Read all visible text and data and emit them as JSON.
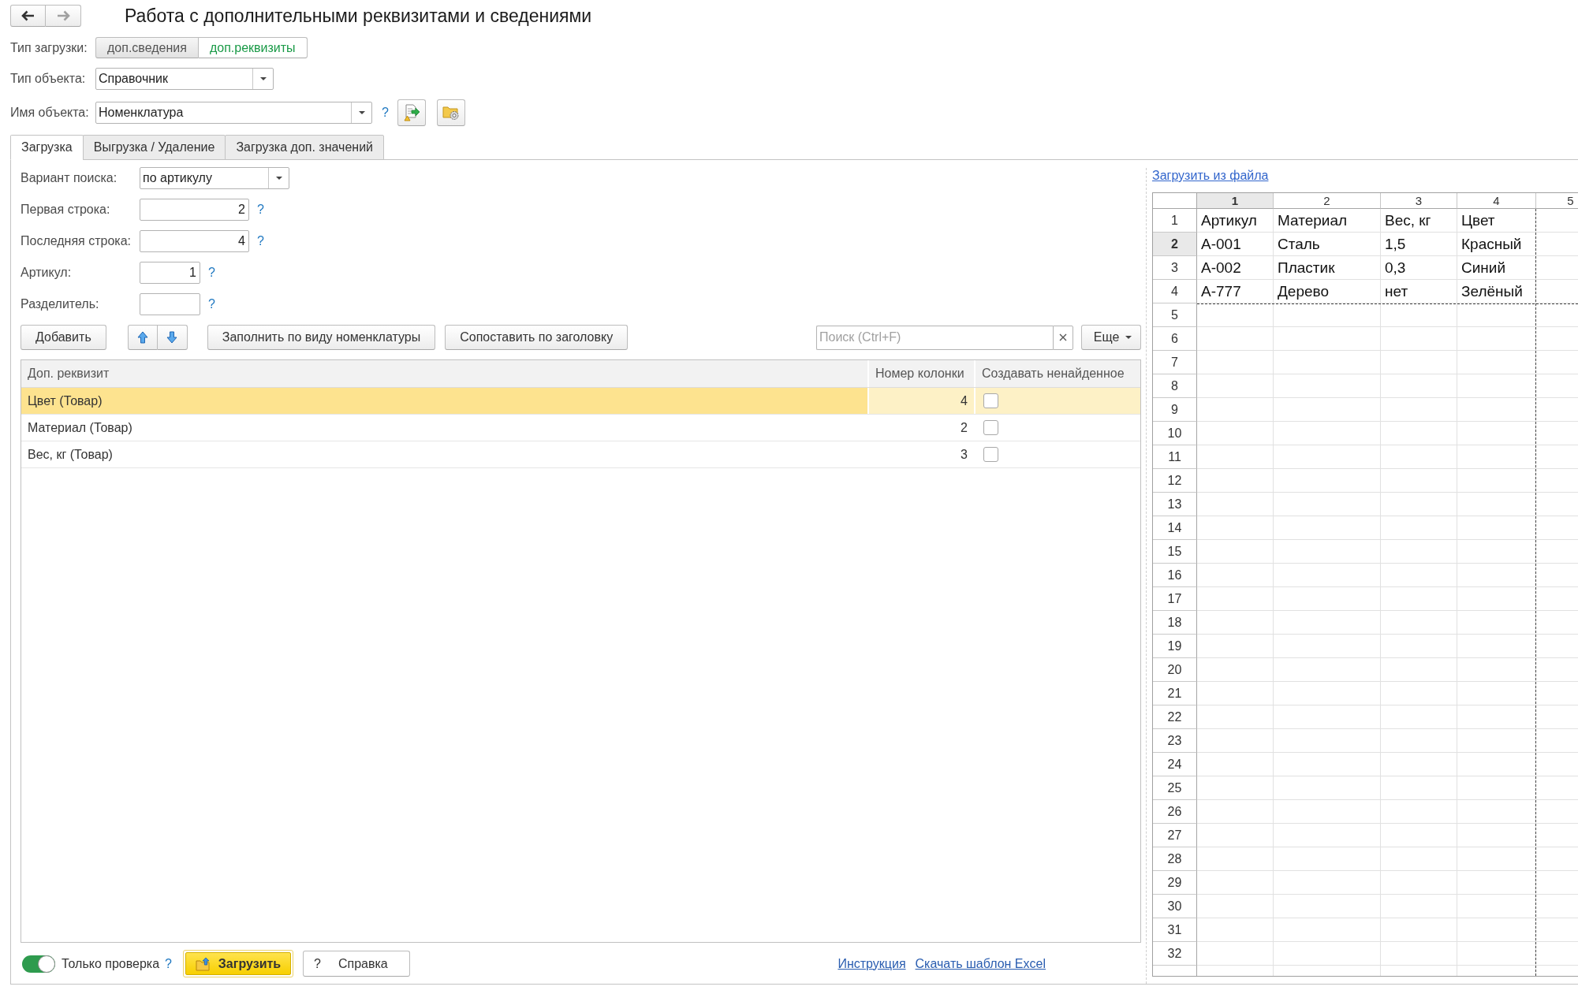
{
  "window": {
    "title": "Работа с дополнительными реквизитами и сведениями"
  },
  "navigation": [
    {
      "kind": "back",
      "disabled": false
    },
    {
      "kind": "forward",
      "disabled": true
    }
  ],
  "load_type": {
    "label": "Тип загрузки:",
    "options": [
      {
        "label": "доп.сведения",
        "selected": false
      },
      {
        "label": "доп.реквизиты",
        "selected": true
      }
    ]
  },
  "object_type": {
    "label": "Тип объекта:",
    "value": "Справочник"
  },
  "object_name": {
    "label": "Имя объекта:",
    "value": "Номенклатура",
    "help": "?"
  },
  "tabs": [
    {
      "label": "Загрузка",
      "selected": true
    },
    {
      "label": "Выгрузка / Удаление",
      "selected": false
    },
    {
      "label": "Загрузка доп. значений",
      "selected": false
    }
  ],
  "settings": [
    {
      "kind": "select",
      "label": "Вариант поиска:",
      "value": "по артикулу"
    },
    {
      "kind": "number",
      "label": "Первая строка:",
      "value": "2",
      "help": "?"
    },
    {
      "kind": "number",
      "label": "Последняя строка:",
      "value": "4",
      "help": "?"
    },
    {
      "kind": "short",
      "label": "Артикул:",
      "value": "1",
      "help": "?"
    },
    {
      "kind": "short",
      "label": "Разделитель:",
      "help": "?"
    }
  ],
  "toolbar": {
    "add": "Добавить",
    "fill": "Заполнить по виду номенклатуры",
    "match": "Сопоставить по заголовку",
    "search": {
      "placeholder": "Поиск (Ctrl+F)"
    },
    "more": "Еще"
  },
  "table": {
    "columns": [
      "Доп. реквизит",
      "Номер колонки",
      "Создавать ненайденное"
    ],
    "rows": [
      {
        "attribute": "Цвет (Товар)",
        "column": "4",
        "create": false,
        "selected": true
      },
      {
        "attribute": "Материал (Товар)",
        "column": "2",
        "create": false,
        "selected": false
      },
      {
        "attribute": "Вес, кг (Товар)",
        "column": "3",
        "create": false,
        "selected": false
      }
    ]
  },
  "footer": {
    "check_only": {
      "label": "Только проверка",
      "on": true,
      "help": "?"
    },
    "load": "Загрузить",
    "help_button": {
      "icon": "?",
      "label": "Справка"
    },
    "links": [
      "Инструкция",
      "Скачать шаблон Excel"
    ]
  },
  "spreadsheet": {
    "link": "Загрузить из файла",
    "columns": [
      {
        "label": "1",
        "selected": true,
        "page_break": false
      },
      {
        "label": "2",
        "selected": false,
        "page_break": false
      },
      {
        "label": "3",
        "selected": false,
        "page_break": false
      },
      {
        "label": "4",
        "selected": false,
        "page_break": true
      },
      {
        "label": "5",
        "selected": false,
        "page_break": false
      }
    ],
    "rows": [
      {
        "label": "1",
        "selected": false,
        "page_break": false,
        "cells": [
          "Артикул",
          "Материал",
          "Вес, кг",
          "Цвет"
        ]
      },
      {
        "label": "2",
        "selected": true,
        "page_break": false,
        "cells": [
          "А-001",
          "Сталь",
          "1,5",
          "Красный"
        ]
      },
      {
        "label": "3",
        "selected": false,
        "page_break": false,
        "cells": [
          "А-002",
          "Пластик",
          "0,3",
          "Синий"
        ]
      },
      {
        "label": "4",
        "selected": false,
        "page_break": true,
        "cells": [
          "А-777",
          "Дерево",
          "нет",
          "Зелёный"
        ]
      },
      {
        "label": "5",
        "selected": false,
        "page_break": false
      },
      {
        "label": "6",
        "selected": false,
        "page_break": false
      },
      {
        "label": "7",
        "selected": false,
        "page_break": false
      },
      {
        "label": "8",
        "selected": false,
        "page_break": false
      },
      {
        "label": "9",
        "selected": false,
        "page_break": false
      },
      {
        "label": "10",
        "selected": false,
        "page_break": false
      },
      {
        "label": "11",
        "selected": false,
        "page_break": false
      },
      {
        "label": "12",
        "selected": false,
        "page_break": false
      },
      {
        "label": "13",
        "selected": false,
        "page_break": false
      },
      {
        "label": "14",
        "selected": false,
        "page_break": false
      },
      {
        "label": "15",
        "selected": false,
        "page_break": false
      },
      {
        "label": "16",
        "selected": false,
        "page_break": false
      },
      {
        "label": "17",
        "selected": false,
        "page_break": false
      },
      {
        "label": "18",
        "selected": false,
        "page_break": false
      },
      {
        "label": "19",
        "selected": false,
        "page_break": false
      },
      {
        "label": "20",
        "selected": false,
        "page_break": false
      },
      {
        "label": "21",
        "selected": false,
        "page_break": false
      },
      {
        "label": "22",
        "selected": false,
        "page_break": false
      },
      {
        "label": "23",
        "selected": false,
        "page_break": false
      },
      {
        "label": "24",
        "selected": false,
        "page_break": false
      },
      {
        "label": "25",
        "selected": false,
        "page_break": false
      },
      {
        "label": "26",
        "selected": false,
        "page_break": false
      },
      {
        "label": "27",
        "selected": false,
        "page_break": false
      },
      {
        "label": "28",
        "selected": false,
        "page_break": false
      },
      {
        "label": "29",
        "selected": false,
        "page_break": false
      },
      {
        "label": "30",
        "selected": false,
        "page_break": false
      },
      {
        "label": "31",
        "selected": false,
        "page_break": false
      },
      {
        "label": "32",
        "selected": false,
        "page_break": false
      }
    ]
  }
}
